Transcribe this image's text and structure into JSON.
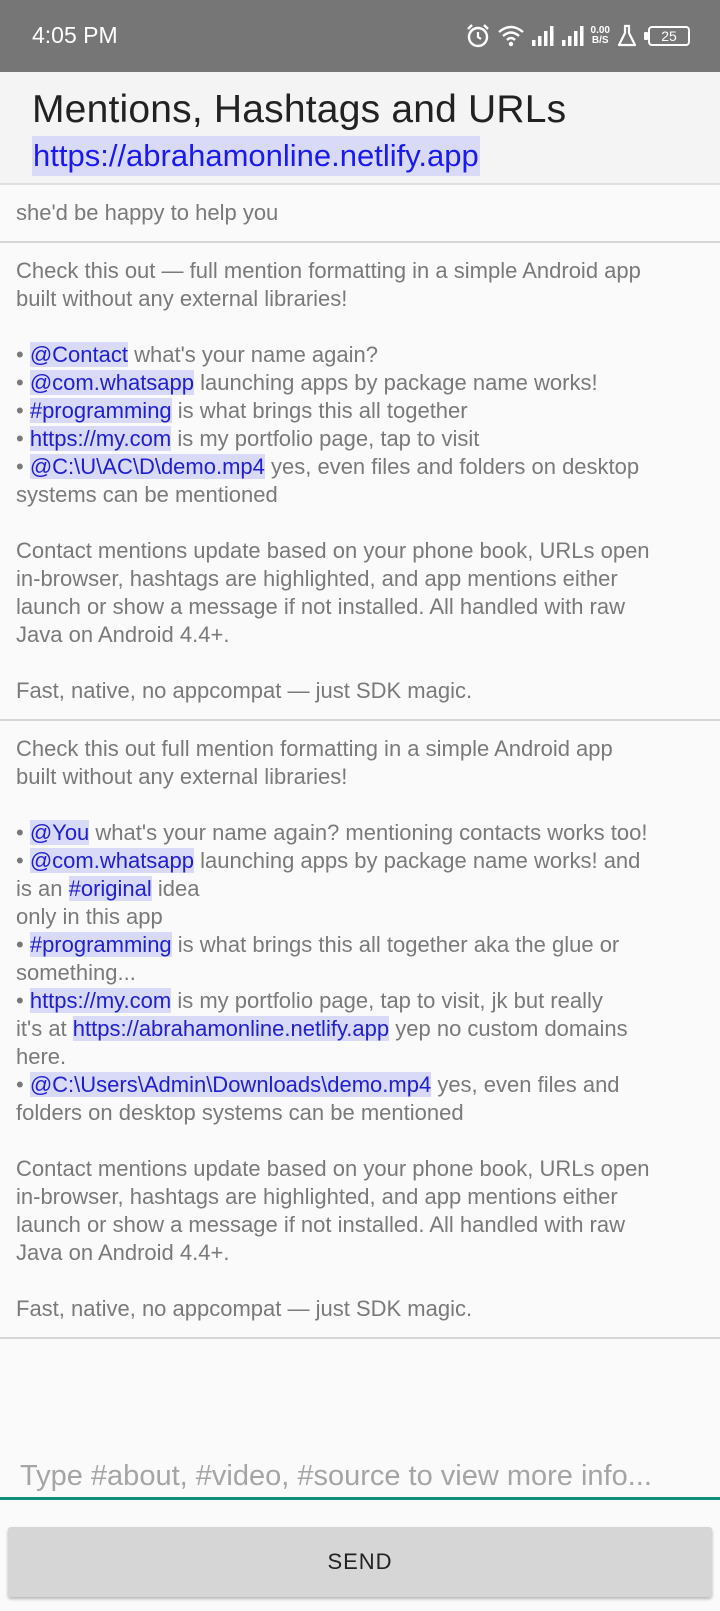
{
  "status_bar": {
    "time": "4:05 PM",
    "net_speed_value": "0.00",
    "net_speed_unit": "B/S",
    "battery": "25"
  },
  "header": {
    "title": "Mentions, Hashtags and URLs",
    "link": "https://abrahamonline.netlify.app"
  },
  "messages": [
    {
      "lines": [
        [
          {
            "t": "she'd be happy to help you"
          }
        ]
      ]
    },
    {
      "lines": [
        [
          {
            "t": "Check this out — full mention formatting in a simple Android app"
          }
        ],
        [
          {
            "t": "built without any external libraries!"
          }
        ],
        [],
        [
          {
            "t": "• "
          },
          {
            "t": "@Contact",
            "m": true
          },
          {
            "t": " what's your name again?"
          }
        ],
        [
          {
            "t": "• "
          },
          {
            "t": "@com.whatsapp",
            "m": true
          },
          {
            "t": " launching apps by package name works!"
          }
        ],
        [
          {
            "t": "• "
          },
          {
            "t": "#programming",
            "m": true
          },
          {
            "t": " is what brings this all together"
          }
        ],
        [
          {
            "t": "• "
          },
          {
            "t": "https://my.com",
            "m": true
          },
          {
            "t": " is my portfolio page, tap to visit"
          }
        ],
        [
          {
            "t": "• "
          },
          {
            "t": "@C:\\U\\AC\\D\\demo.mp4",
            "m": true
          },
          {
            "t": " yes, even files and folders on desktop"
          }
        ],
        [
          {
            "t": "systems can be mentioned"
          }
        ],
        [],
        [
          {
            "t": "Contact mentions update based on your phone book, URLs open"
          }
        ],
        [
          {
            "t": "in-browser, hashtags are highlighted, and app mentions either"
          }
        ],
        [
          {
            "t": "launch or show a message if not installed. All handled with raw"
          }
        ],
        [
          {
            "t": "Java on Android 4.4+."
          }
        ],
        [],
        [
          {
            "t": "Fast, native, no appcompat — just SDK magic."
          }
        ]
      ]
    },
    {
      "lines": [
        [
          {
            "t": "Check this out full mention formatting in a simple Android app"
          }
        ],
        [
          {
            "t": "built without any external libraries!"
          }
        ],
        [],
        [
          {
            "t": "• "
          },
          {
            "t": "@You",
            "m": true
          },
          {
            "t": " what's your name again? mentioning contacts works too!"
          }
        ],
        [
          {
            "t": "• "
          },
          {
            "t": "@com.whatsapp",
            "m": true
          },
          {
            "t": " launching apps by package name works! and"
          }
        ],
        [
          {
            "t": "is an "
          },
          {
            "t": "#original",
            "m": true
          },
          {
            "t": " idea"
          }
        ],
        [
          {
            "t": "only in this app"
          }
        ],
        [
          {
            "t": "• "
          },
          {
            "t": "#programming",
            "m": true
          },
          {
            "t": " is what brings this all together aka the glue or"
          }
        ],
        [
          {
            "t": "something..."
          }
        ],
        [
          {
            "t": "• "
          },
          {
            "t": "https://my.com",
            "m": true
          },
          {
            "t": " is my portfolio page, tap to visit, jk but really"
          }
        ],
        [
          {
            "t": "it's at "
          },
          {
            "t": "https://abrahamonline.netlify.app",
            "m": true
          },
          {
            "t": " yep no custom domains"
          }
        ],
        [
          {
            "t": "here."
          }
        ],
        [
          {
            "t": "• "
          },
          {
            "t": "@C:\\Users\\Admin\\Downloads\\demo.mp4",
            "m": true
          },
          {
            "t": " yes, even files and"
          }
        ],
        [
          {
            "t": "folders on desktop systems can be mentioned"
          }
        ],
        [],
        [
          {
            "t": "Contact mentions update based on your phone book, URLs open"
          }
        ],
        [
          {
            "t": "in-browser, hashtags are highlighted, and app mentions either"
          }
        ],
        [
          {
            "t": "launch or show a message if not installed. All handled with raw"
          }
        ],
        [
          {
            "t": "Java on Android 4.4+."
          }
        ],
        [],
        [
          {
            "t": "Fast, native, no appcompat — just SDK magic."
          }
        ]
      ]
    }
  ],
  "composer": {
    "placeholder": "Type #about, #video, #source to view more info...",
    "value": ""
  },
  "send_button": {
    "label": "SEND"
  },
  "colors": {
    "status_bar": "#767676",
    "mention_bg": "#d9daf7",
    "mention_text": "#2020cc",
    "input_underline": "#0f8f7a",
    "send_button": "#d6d6d6"
  }
}
